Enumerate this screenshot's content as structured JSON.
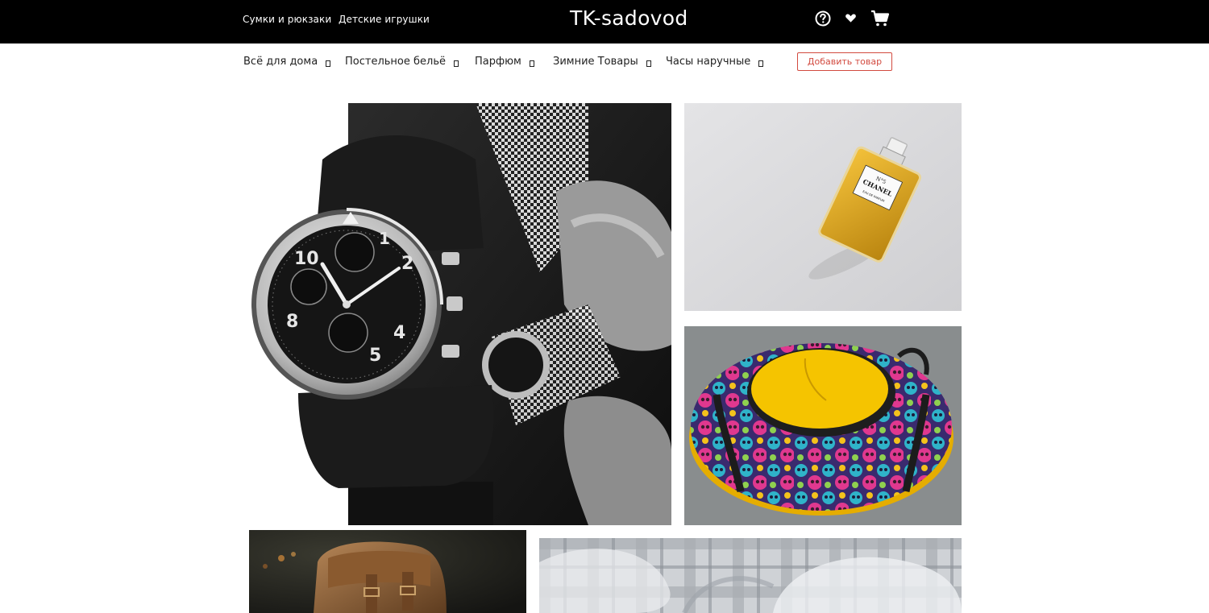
{
  "header": {
    "links": [
      "Сумки и рюкзаки",
      "Детские игрушки"
    ],
    "brand": "TK-sadovod",
    "icons": [
      "help-circle-icon",
      "heart-icon",
      "cart-icon"
    ]
  },
  "nav": {
    "items": [
      "Всё для дома",
      "Постельное бельё",
      "Парфюм",
      "Зимние Товары",
      "Часы наручные"
    ],
    "add_button": "Добавить товар"
  },
  "tiles": {
    "watch": {
      "numerals": [
        "10",
        "2",
        "8",
        "4",
        "5",
        "1"
      ]
    },
    "perfume": {
      "brand": "CHANEL",
      "label_top": "N°5",
      "label_bottom": "EAU DE PARFUM"
    }
  },
  "colors": {
    "header_bg": "#000000",
    "accent": "#d24a3f",
    "perfume_bg": "#dcdcde",
    "tube_bg": "#8a8e8e",
    "tube_yellow": "#f7c400"
  }
}
